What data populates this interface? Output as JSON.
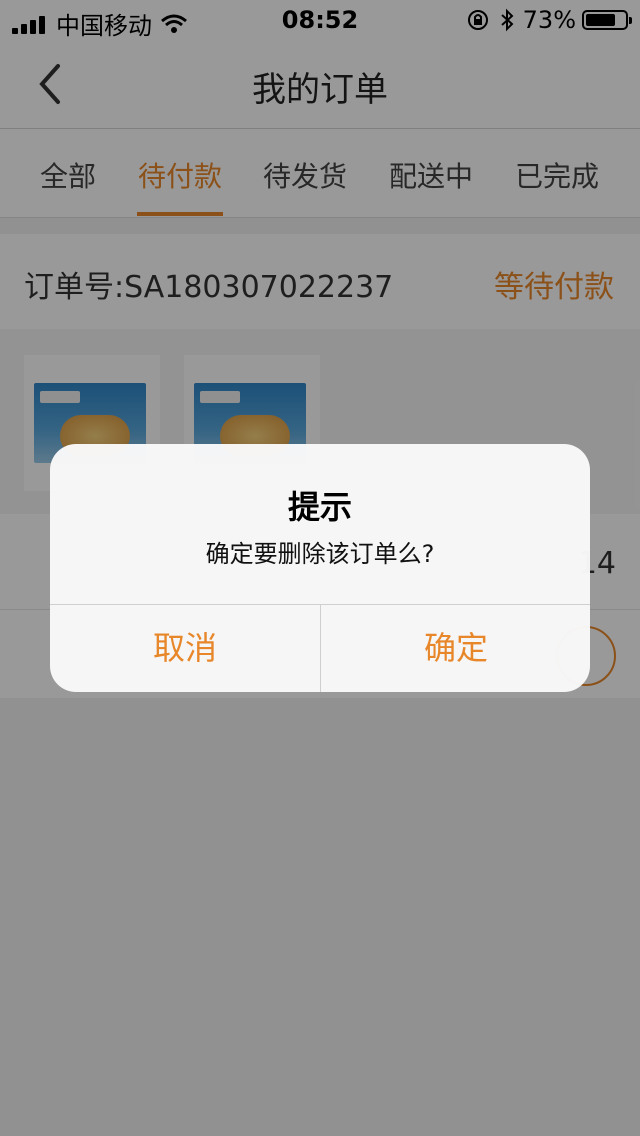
{
  "status_bar": {
    "carrier": "中国移动",
    "time": "08:52",
    "battery": "73%",
    "battery_level": 0.73
  },
  "nav": {
    "title": "我的订单",
    "back_icon": "chevron-left-icon"
  },
  "tabs": [
    {
      "label": "全部",
      "active": false
    },
    {
      "label": "待付款",
      "active": true
    },
    {
      "label": "待发货",
      "active": false
    },
    {
      "label": "配送中",
      "active": false
    },
    {
      "label": "已完成",
      "active": false
    }
  ],
  "order": {
    "number": "订单号:SA180307022237",
    "status": "等待付款",
    "total_partial": "14"
  },
  "alert": {
    "title": "提示",
    "message": "确定要删除该订单么?",
    "cancel": "取消",
    "confirm": "确定"
  },
  "colors": {
    "accent": "#e8872a",
    "overlay": "rgba(0,0,0,0.4)"
  }
}
